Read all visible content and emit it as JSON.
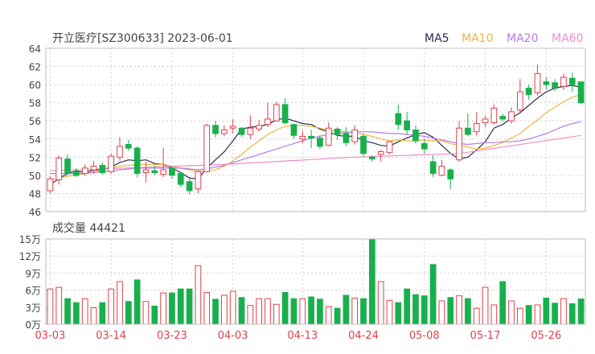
{
  "header": {
    "title": "开立医疗[SZ300633] 2023-06-01"
  },
  "legend": [
    {
      "label": "MA5",
      "color": "#2b2b55"
    },
    {
      "label": "MA10",
      "color": "#f0b542"
    },
    {
      "label": "MA20",
      "color": "#b77be0"
    },
    {
      "label": "MA60",
      "color": "#f08cc4"
    }
  ],
  "colors": {
    "up": "#e0414a",
    "down": "#18b04c",
    "grid": "#cfcfcf",
    "text": "#444444"
  },
  "chart_data": [
    {
      "type": "candlestick",
      "yticks": [
        "64",
        "62",
        "60",
        "58",
        "56",
        "54",
        "52",
        "50",
        "48",
        "46"
      ],
      "ylim": [
        46,
        64
      ],
      "xticks": [
        {
          "label": "03-03",
          "index": 0
        },
        {
          "label": "03-14",
          "index": 7
        },
        {
          "label": "03-23",
          "index": 14
        },
        {
          "label": "04-03",
          "index": 21
        },
        {
          "label": "04-13",
          "index": 29
        },
        {
          "label": "04-24",
          "index": 36
        },
        {
          "label": "05-08",
          "index": 43
        },
        {
          "label": "05-17",
          "index": 50
        },
        {
          "label": "05-26",
          "index": 57
        }
      ],
      "ohlc": [
        [
          48.3,
          49.6,
          48.0,
          49.9
        ],
        [
          49.5,
          51.9,
          49.0,
          52.2
        ],
        [
          51.8,
          50.2,
          50.0,
          52.3
        ],
        [
          50.4,
          50.0,
          49.8,
          50.8
        ],
        [
          50.2,
          50.8,
          49.9,
          51.2
        ],
        [
          50.6,
          51.0,
          50.2,
          51.6
        ],
        [
          51.1,
          50.3,
          50.1,
          51.4
        ],
        [
          50.4,
          52.1,
          50.2,
          52.4
        ],
        [
          52.0,
          53.2,
          51.6,
          54.2
        ],
        [
          53.4,
          53.0,
          52.7,
          53.9
        ],
        [
          53.0,
          50.2,
          49.8,
          53.2
        ],
        [
          50.3,
          50.6,
          49.2,
          51.5
        ],
        [
          50.5,
          50.3,
          50.0,
          51.1
        ],
        [
          50.1,
          50.6,
          49.8,
          53.0
        ],
        [
          50.8,
          50.0,
          49.6,
          51.0
        ],
        [
          50.2,
          49.0,
          48.7,
          50.4
        ],
        [
          49.3,
          48.3,
          47.9,
          49.8
        ],
        [
          48.5,
          50.4,
          48.0,
          50.6
        ],
        [
          50.4,
          55.5,
          50.3,
          55.7
        ],
        [
          55.5,
          54.6,
          54.2,
          56.0
        ],
        [
          54.6,
          55.0,
          54.3,
          55.5
        ],
        [
          55.2,
          55.4,
          54.6,
          56.2
        ],
        [
          55.2,
          54.5,
          54.2,
          55.3
        ],
        [
          54.5,
          55.2,
          54.0,
          56.6
        ],
        [
          55.1,
          55.5,
          54.8,
          56.1
        ],
        [
          55.6,
          56.2,
          55.3,
          58.0
        ],
        [
          56.0,
          57.8,
          55.9,
          58.1
        ],
        [
          57.8,
          55.8,
          55.6,
          58.5
        ],
        [
          55.6,
          54.4,
          54.0,
          55.7
        ],
        [
          54.0,
          54.3,
          53.5,
          54.9
        ],
        [
          54.3,
          54.1,
          53.0,
          55.0
        ],
        [
          54.1,
          53.2,
          52.9,
          54.4
        ],
        [
          53.3,
          55.2,
          53.2,
          55.8
        ],
        [
          55.1,
          54.5,
          53.9,
          55.3
        ],
        [
          54.6,
          53.6,
          53.2,
          55.3
        ],
        [
          53.7,
          55.0,
          53.4,
          55.5
        ],
        [
          54.3,
          52.4,
          52.0,
          54.5
        ],
        [
          52.0,
          51.8,
          51.5,
          52.2
        ],
        [
          52.3,
          52.6,
          51.5,
          52.8
        ],
        [
          52.5,
          53.7,
          52.3,
          53.8
        ],
        [
          56.8,
          55.6,
          55.0,
          57.8
        ],
        [
          56.0,
          55.0,
          54.5,
          57.0
        ],
        [
          55.0,
          53.8,
          53.5,
          55.5
        ],
        [
          53.5,
          52.9,
          52.4,
          54.0
        ],
        [
          51.5,
          50.2,
          49.8,
          52.2
        ],
        [
          50.0,
          51.0,
          49.9,
          51.7
        ],
        [
          50.6,
          49.6,
          48.5,
          50.8
        ],
        [
          51.7,
          55.2,
          51.5,
          56.0
        ],
        [
          55.2,
          54.5,
          54.3,
          56.8
        ],
        [
          54.8,
          55.7,
          54.4,
          57.0
        ],
        [
          55.8,
          56.2,
          55.3,
          56.6
        ],
        [
          55.8,
          57.4,
          55.6,
          57.8
        ],
        [
          56.5,
          56.2,
          55.9,
          56.8
        ],
        [
          56.0,
          57.0,
          55.7,
          57.5
        ],
        [
          57.2,
          59.2,
          56.8,
          60.6
        ],
        [
          59.6,
          58.9,
          58.3,
          60.0
        ],
        [
          59.1,
          61.2,
          58.8,
          62.2
        ],
        [
          60.3,
          60.0,
          59.5,
          60.8
        ],
        [
          60.2,
          59.6,
          59.3,
          60.6
        ],
        [
          59.8,
          60.8,
          59.4,
          61.2
        ],
        [
          60.7,
          60.0,
          59.2,
          61.3
        ],
        [
          60.3,
          58.0,
          57.8,
          60.3
        ]
      ],
      "ma": {
        "MA5": [
          49.0,
          49.6,
          50.2,
          50.5,
          50.3,
          50.6,
          50.6,
          50.9,
          51.4,
          51.7,
          51.6,
          51.7,
          51.3,
          51.2,
          50.8,
          50.3,
          49.7,
          49.6,
          50.8,
          51.7,
          52.6,
          53.8,
          55.1,
          55.3,
          55.4,
          55.6,
          56.1,
          56.3,
          56.0,
          55.7,
          55.6,
          55.1,
          54.8,
          54.4,
          54.3,
          54.3,
          53.8,
          53.6,
          53.3,
          53.2,
          53.7,
          54.1,
          54.5,
          54.7,
          54.2,
          53.3,
          52.4,
          51.8,
          52.0,
          52.8,
          53.7,
          55.2,
          55.6,
          56.3,
          56.9,
          57.7,
          58.5,
          59.2,
          59.6,
          59.8,
          59.9,
          59.7
        ],
        "MA10": [
          49.5,
          49.7,
          49.9,
          50.0,
          50.2,
          50.4,
          50.6,
          50.8,
          51.0,
          51.1,
          51.2,
          51.2,
          51.2,
          51.2,
          51.0,
          50.8,
          50.6,
          50.4,
          50.5,
          50.6,
          51.0,
          51.6,
          52.3,
          53.1,
          53.8,
          54.5,
          55.0,
          55.4,
          55.5,
          55.5,
          55.4,
          55.2,
          55.0,
          54.9,
          54.8,
          54.7,
          54.5,
          54.3,
          54.0,
          53.8,
          53.9,
          53.8,
          53.8,
          53.9,
          53.8,
          53.8,
          53.5,
          53.3,
          53.1,
          52.9,
          53.0,
          53.3,
          53.6,
          54.1,
          54.6,
          55.4,
          56.1,
          56.9,
          57.5,
          58.1,
          58.6,
          58.9
        ],
        "MA20": [
          50.2,
          50.2,
          50.2,
          50.2,
          50.2,
          50.3,
          50.4,
          50.5,
          50.6,
          50.7,
          50.8,
          50.8,
          50.8,
          50.8,
          50.8,
          50.8,
          50.7,
          50.6,
          50.7,
          50.9,
          51.1,
          51.4,
          51.7,
          52.0,
          52.3,
          52.6,
          52.9,
          53.2,
          53.5,
          53.8,
          54.1,
          54.3,
          54.5,
          54.6,
          54.7,
          54.8,
          54.8,
          54.8,
          54.7,
          54.6,
          54.6,
          54.5,
          54.4,
          54.3,
          54.1,
          53.9,
          53.7,
          53.5,
          53.4,
          53.5,
          53.6,
          53.6,
          53.7,
          53.7,
          53.8,
          54.0,
          54.3,
          54.6,
          55.0,
          55.4,
          55.7,
          55.9
        ]
      },
      "ma60_line": [
        [
          0,
          50.5
        ],
        [
          20,
          51.2
        ],
        [
          35,
          52.0
        ],
        [
          47,
          52.4
        ],
        [
          61,
          54.4
        ]
      ]
    },
    {
      "type": "bar",
      "title": "成交量 44421",
      "yticks": [
        "15万",
        "12万",
        "9万",
        "6万",
        "3万",
        "0万"
      ],
      "ylim": [
        0,
        150000
      ],
      "volume": [
        62000,
        65000,
        45000,
        38000,
        45000,
        29000,
        38000,
        62000,
        75000,
        40000,
        78000,
        40000,
        32000,
        55000,
        55000,
        62000,
        62000,
        103000,
        56000,
        44000,
        51000,
        58000,
        47000,
        33000,
        45000,
        45000,
        35000,
        56000,
        45000,
        45000,
        48000,
        44000,
        31000,
        28000,
        51000,
        46000,
        45000,
        150000,
        75000,
        42000,
        38000,
        62000,
        52000,
        50000,
        105000,
        41000,
        47000,
        50000,
        45000,
        28000,
        65000,
        34000,
        75000,
        41000,
        28000,
        33000,
        34000,
        46000,
        37000,
        45000,
        36000,
        44421
      ]
    }
  ]
}
